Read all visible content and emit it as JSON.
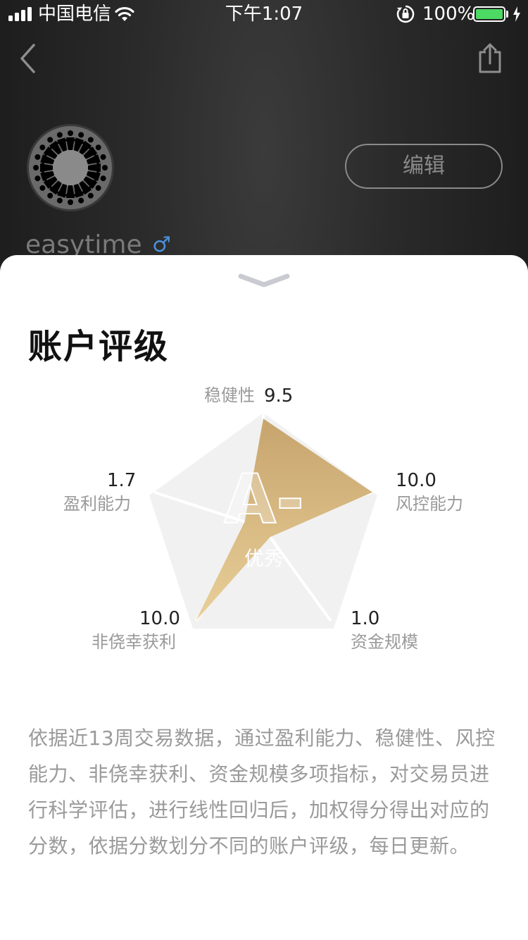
{
  "status_bar": {
    "carrier": "中国电信",
    "time": "下午1:07",
    "battery_percent": "100%"
  },
  "header": {
    "back_icon": "chevron-left-icon",
    "share_icon": "share-icon",
    "edit_label": "编辑",
    "username": "easytime",
    "gender_symbol": "♂"
  },
  "sheet": {
    "handle_icon": "chevron-down-icon",
    "title": "账户评级",
    "grade": "A-",
    "grade_desc": "优秀",
    "metrics": [
      {
        "name": "稳健性",
        "value": "9.5"
      },
      {
        "name": "风控能力",
        "value": "10.0"
      },
      {
        "name": "资金规模",
        "value": "1.0"
      },
      {
        "name": "非侥幸获利",
        "value": "10.0"
      },
      {
        "name": "盈利能力",
        "value": "1.7"
      }
    ],
    "description": "依据近13周交易数据，通过盈利能力、稳健性、风控能力、非侥幸获利、资金规模多项指标，对交易员进行科学评估，进行线性回归后，加权得分得出对应的分数，依据分数划分不同的账户评级，每日更新。"
  },
  "colors": {
    "accent_gold": "#c9a56a",
    "battery_green": "#4cd964",
    "radar_bg": "#f0f0f0"
  }
}
